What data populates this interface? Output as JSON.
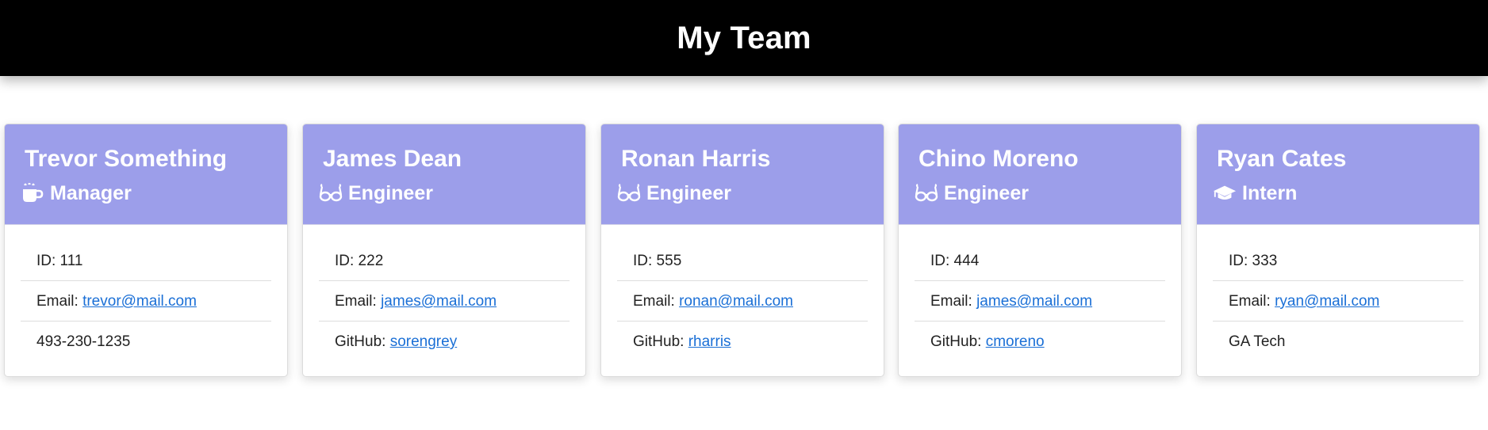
{
  "header": {
    "title": "My Team"
  },
  "colors": {
    "card_header": "#9c9eea",
    "link": "#1a6fd6",
    "page_header": "#000000"
  },
  "team": [
    {
      "name": "Trevor Something",
      "role": "Manager",
      "icon": "coffee-icon",
      "id_text": "ID: 111",
      "email_label": "Email: ",
      "email": "trevor@mail.com",
      "extra_label": "",
      "extra_value": "493-230-1235"
    },
    {
      "name": "James Dean",
      "role": "Engineer",
      "icon": "glasses-icon",
      "id_text": "ID: 222",
      "email_label": "Email: ",
      "email": "james@mail.com",
      "extra_label": "GitHub: ",
      "extra_value": "sorengrey"
    },
    {
      "name": "Ronan Harris",
      "role": "Engineer",
      "icon": "glasses-icon",
      "id_text": "ID: 555",
      "email_label": "Email: ",
      "email": "ronan@mail.com",
      "extra_label": "GitHub: ",
      "extra_value": "rharris"
    },
    {
      "name": "Chino Moreno",
      "role": "Engineer",
      "icon": "glasses-icon",
      "id_text": "ID: 444",
      "email_label": "Email: ",
      "email": "james@mail.com",
      "extra_label": "GitHub: ",
      "extra_value": "cmoreno"
    },
    {
      "name": "Ryan Cates",
      "role": "Intern",
      "icon": "graduation-cap-icon",
      "id_text": "ID: 333",
      "email_label": "Email: ",
      "email": "ryan@mail.com",
      "extra_label": "",
      "extra_value": "GA Tech"
    }
  ]
}
